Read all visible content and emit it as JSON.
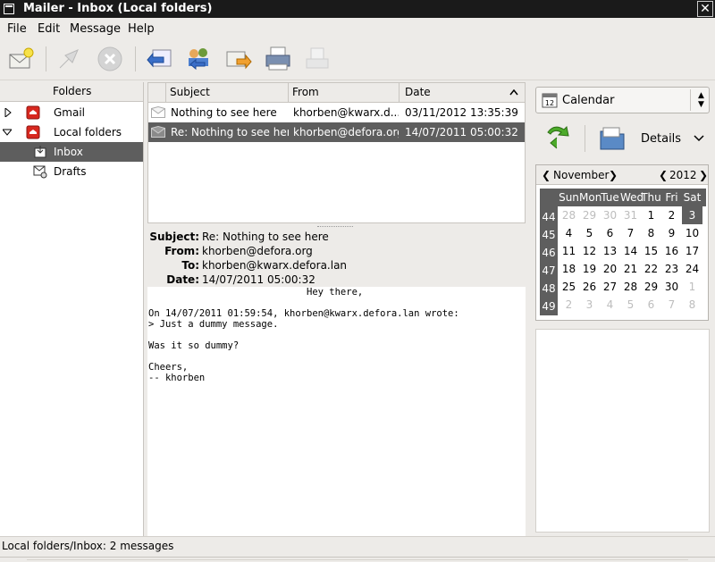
{
  "window": {
    "title": "Mailer - Inbox (Local folders)"
  },
  "menu": {
    "file": "File",
    "edit": "Edit",
    "message": "Message",
    "help": "Help"
  },
  "toolbar": [
    "new-message",
    "fetch",
    "stop",
    "reply",
    "reply-all",
    "forward",
    "print",
    "save"
  ],
  "folders": {
    "header": "Folders",
    "items": [
      {
        "label": "Gmail",
        "expanded": false
      },
      {
        "label": "Local folders",
        "expanded": true
      },
      {
        "label": "Inbox",
        "selected": true
      },
      {
        "label": "Drafts"
      }
    ]
  },
  "messages": {
    "columns": {
      "subject": "Subject",
      "from": "From",
      "date": "Date"
    },
    "rows": [
      {
        "subject": "Nothing to see here",
        "from": "khorben@kwarx.d...",
        "date": "03/11/2012 13:35:39"
      },
      {
        "subject": "Re: Nothing to see here",
        "from": "khorben@defora.org",
        "date": "14/07/2011 05:00:32",
        "selected": true
      }
    ]
  },
  "viewer": {
    "labels": {
      "subject": "Subject:",
      "from": "From:",
      "to": "To:",
      "date": "Date:"
    },
    "subject": "Re: Nothing to see here",
    "from": "khorben@defora.org",
    "to": "khorben@kwarx.defora.lan",
    "date": "14/07/2011 05:00:32",
    "body": [
      "                            Hey there,",
      "",
      "On 14/07/2011 01:59:54, khorben@kwarx.defora.lan wrote:",
      "> Just a dummy message.",
      "",
      "Was it so dummy?",
      "",
      "Cheers,",
      "-- khorben"
    ]
  },
  "calendar": {
    "combo_label": "Calendar",
    "combo_icon_day": "12",
    "details_label": "Details",
    "month": "November",
    "year": "2012",
    "weekdays": [
      "Sun",
      "Mon",
      "Tue",
      "Wed",
      "Thu",
      "Fri",
      "Sat"
    ],
    "weeks": [
      {
        "num": "44",
        "days": [
          [
            "28",
            1
          ],
          [
            "29",
            1
          ],
          [
            "30",
            1
          ],
          [
            "31",
            1
          ],
          [
            "1",
            0
          ],
          [
            "2",
            0
          ],
          [
            "3",
            2
          ]
        ]
      },
      {
        "num": "45",
        "days": [
          [
            "4",
            0
          ],
          [
            "5",
            0
          ],
          [
            "6",
            0
          ],
          [
            "7",
            0
          ],
          [
            "8",
            0
          ],
          [
            "9",
            0
          ],
          [
            "10",
            0
          ]
        ]
      },
      {
        "num": "46",
        "days": [
          [
            "11",
            0
          ],
          [
            "12",
            0
          ],
          [
            "13",
            0
          ],
          [
            "14",
            0
          ],
          [
            "15",
            0
          ],
          [
            "16",
            0
          ],
          [
            "17",
            0
          ]
        ]
      },
      {
        "num": "47",
        "days": [
          [
            "18",
            0
          ],
          [
            "19",
            0
          ],
          [
            "20",
            0
          ],
          [
            "21",
            0
          ],
          [
            "22",
            0
          ],
          [
            "23",
            0
          ],
          [
            "24",
            0
          ]
        ]
      },
      {
        "num": "48",
        "days": [
          [
            "25",
            0
          ],
          [
            "26",
            0
          ],
          [
            "27",
            0
          ],
          [
            "28",
            0
          ],
          [
            "29",
            0
          ],
          [
            "30",
            0
          ],
          [
            "1",
            1
          ]
        ]
      },
      {
        "num": "49",
        "days": [
          [
            "2",
            1
          ],
          [
            "3",
            1
          ],
          [
            "4",
            1
          ],
          [
            "5",
            1
          ],
          [
            "6",
            1
          ],
          [
            "7",
            1
          ],
          [
            "8",
            1
          ]
        ]
      }
    ]
  },
  "status": {
    "text": "Local folders/Inbox: 2 messages"
  },
  "colors": {
    "selection": "#5e5e5e",
    "window_bg": "#edebe8"
  }
}
